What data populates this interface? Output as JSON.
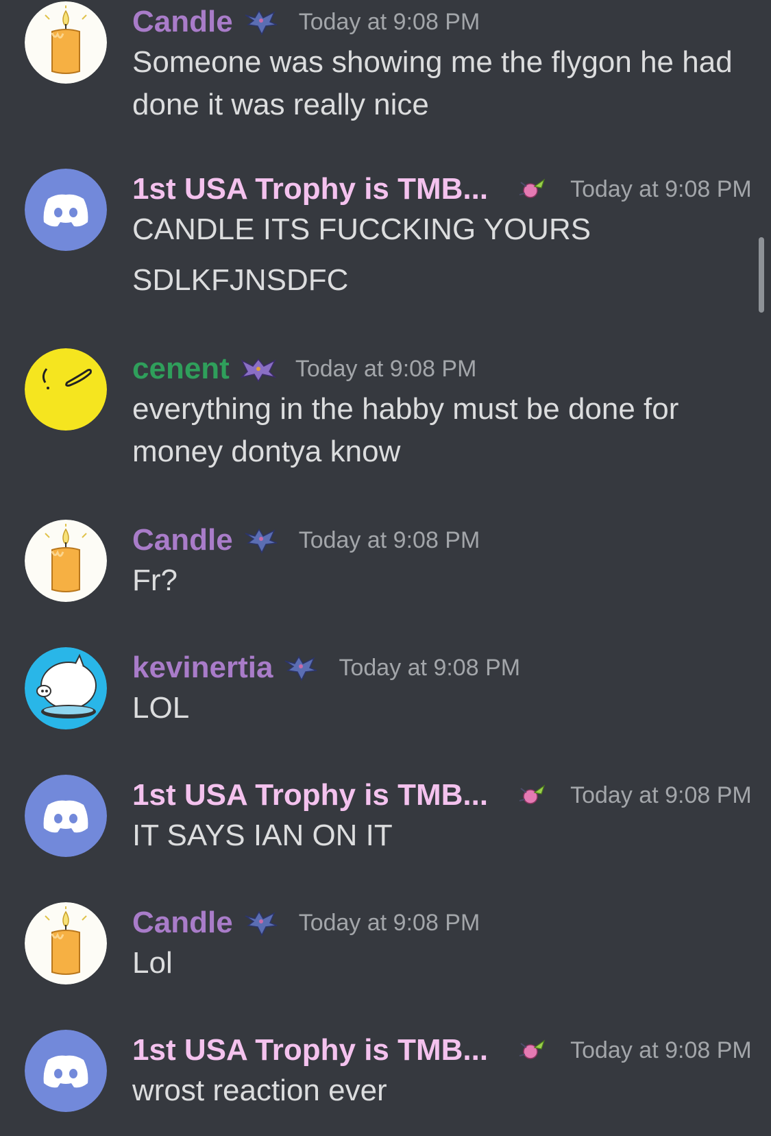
{
  "colors": {
    "background": "#36393f",
    "username_purple": "#a97cc9",
    "username_pink": "#f4c2ee",
    "username_green": "#2f9f5b",
    "timestamp": "#a3a6aa",
    "message_text": "#dcddde",
    "discord_blurple": "#7289da"
  },
  "messages": [
    {
      "avatar": "candle-avatar",
      "username": "Candle",
      "badge": "zubat-badge",
      "timestamp": "Today at 9:08 PM",
      "lines": [
        "Someone was showing me the flygon he had",
        "done it was really nice"
      ]
    },
    {
      "avatar": "discord-default-avatar",
      "username": "1st USA Trophy is TMB...",
      "badge": "hoppip-badge",
      "timestamp": "Today at 9:08 PM",
      "lines": [
        "CANDLE ITS FUCCKING YOURS",
        "SDLKFJNSDFC"
      ]
    },
    {
      "avatar": "yellow-face-avatar",
      "username": "cenent",
      "badge": "crobat-badge",
      "timestamp": "Today at 9:08 PM",
      "lines": [
        "everything in the habby must be done for",
        "money dontya know"
      ]
    },
    {
      "avatar": "candle-avatar",
      "username": "Candle",
      "badge": "zubat-badge",
      "timestamp": "Today at 9:08 PM",
      "lines": [
        "Fr?"
      ]
    },
    {
      "avatar": "pig-avatar",
      "username": "kevinertia",
      "badge": "zubat-badge",
      "timestamp": "Today at 9:08 PM",
      "lines": [
        "LOL"
      ]
    },
    {
      "avatar": "discord-default-avatar",
      "username": "1st USA Trophy is TMB...",
      "badge": "hoppip-badge",
      "timestamp": "Today at 9:08 PM",
      "lines": [
        "IT SAYS IAN ON IT"
      ]
    },
    {
      "avatar": "candle-avatar",
      "username": "Candle",
      "badge": "zubat-badge",
      "timestamp": "Today at 9:08 PM",
      "lines": [
        "Lol"
      ]
    },
    {
      "avatar": "discord-default-avatar",
      "username": "1st USA Trophy is TMB...",
      "badge": "hoppip-badge",
      "timestamp": "Today at 9:08 PM",
      "lines": [
        "wrost reaction ever"
      ]
    }
  ]
}
